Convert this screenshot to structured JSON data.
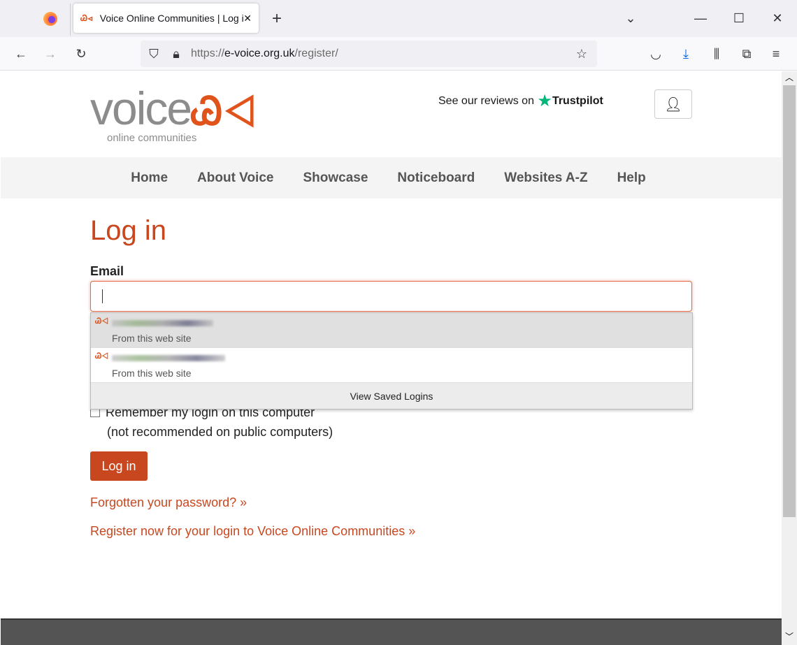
{
  "browser": {
    "tab_title": "Voice Online Communities | Log in",
    "url_scheme": "https://",
    "url_host": "e-voice.org.uk",
    "url_path": "/register/"
  },
  "header": {
    "logo_word": "voice",
    "logo_sub": "online communities",
    "reviews_text": "See our reviews on",
    "trustpilot": "Trustpilot"
  },
  "nav": {
    "items": [
      "Home",
      "About Voice",
      "Showcase",
      "Noticeboard",
      "Websites A-Z",
      "Help"
    ]
  },
  "main": {
    "title": "Log in",
    "email_label": "Email",
    "email_value": "",
    "autocomplete": {
      "items": [
        {
          "source": "From this web site"
        },
        {
          "source": "From this web site"
        }
      ],
      "view_saved": "View Saved Logins"
    },
    "remember_label": "Remember my login on this computer",
    "remember_note": "(not recommended on public computers)",
    "login_button": "Log in",
    "forgot_link": "Forgotten your password? »",
    "register_link": "Register now for your login to Voice Online Communities »"
  },
  "colors": {
    "accent": "#c9471f",
    "logo_orange": "#e0531b",
    "trustpilot_green": "#00b67a"
  }
}
